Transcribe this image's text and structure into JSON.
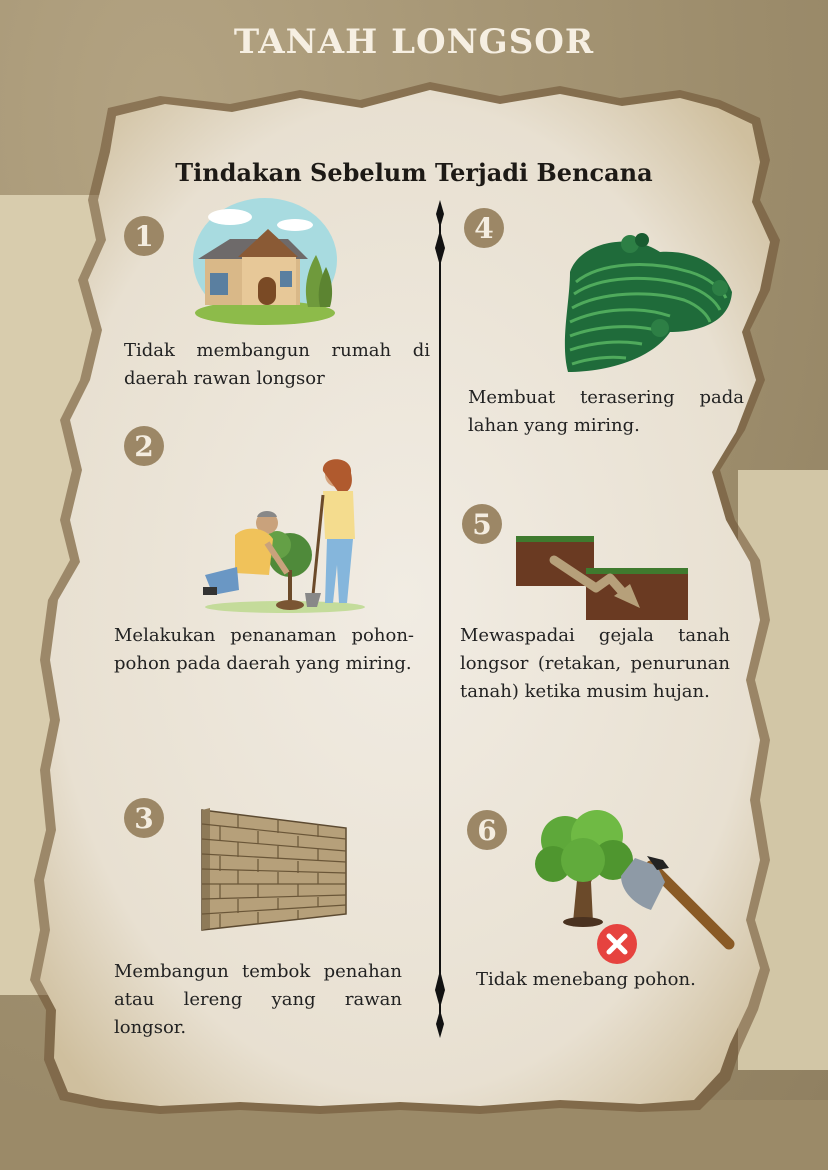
{
  "title": "TANAH LONGSOR",
  "subtitle": "Tindakan Sebelum Terjadi Bencana",
  "items": [
    {
      "number": "1",
      "text": "Tidak membangun rumah di daerah rawan longsor",
      "icon": "house-icon"
    },
    {
      "number": "2",
      "text": "Melakukan penanaman pohon-pohon pada daerah yang miring.",
      "icon": "tree-planting-icon"
    },
    {
      "number": "3",
      "text": "Membangun tembok penahan atau lereng yang rawan longsor.",
      "icon": "brick-wall-icon"
    },
    {
      "number": "4",
      "text": "Membuat terasering pada lahan yang miring.",
      "icon": "terrace-field-icon"
    },
    {
      "number": "5",
      "text": "Mewaspadai gejala tanah longsor (retakan, penurunan tanah) ketika musim hujan.",
      "icon": "ground-crack-icon"
    },
    {
      "number": "6",
      "text": "Tidak menebang pohon.",
      "icon": "no-tree-cutting-icon"
    }
  ],
  "colors": {
    "number_badge": "#9c8766",
    "paper": "#ece5d8",
    "kraft": "#a89877"
  }
}
